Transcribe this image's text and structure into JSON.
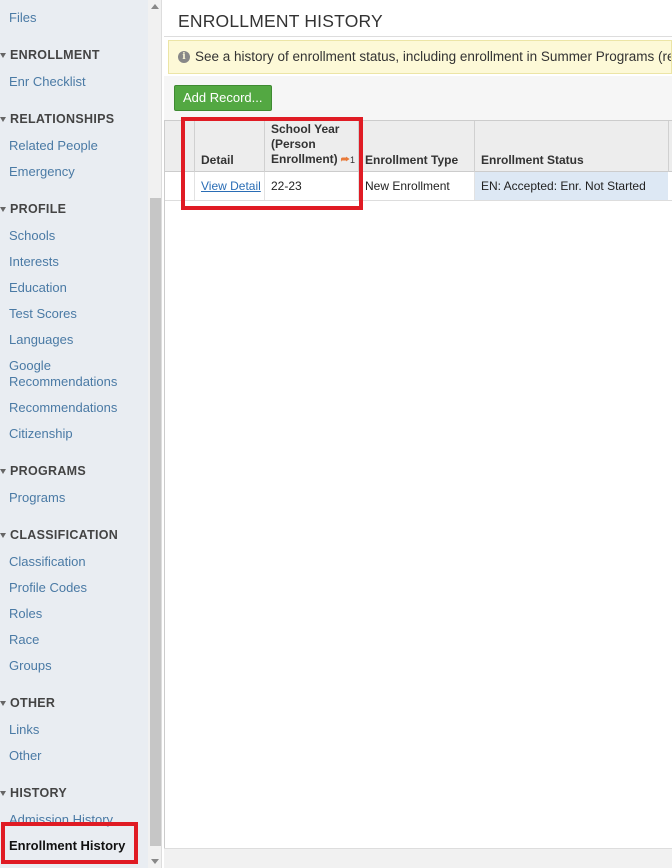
{
  "sidebar": {
    "top_link": "Files",
    "sections": [
      {
        "title": "ENROLLMENT",
        "items": [
          "Enr Checklist"
        ]
      },
      {
        "title": "RELATIONSHIPS",
        "items": [
          "Related People",
          "Emergency"
        ]
      },
      {
        "title": "PROFILE",
        "items": [
          "Schools",
          "Interests",
          "Education",
          "Test Scores",
          "Languages",
          "Google Recommendations",
          "Recommendations",
          "Citizenship"
        ]
      },
      {
        "title": "PROGRAMS",
        "items": [
          "Programs"
        ]
      },
      {
        "title": "CLASSIFICATION",
        "items": [
          "Classification",
          "Profile Codes",
          "Roles",
          "Race",
          "Groups"
        ]
      },
      {
        "title": "OTHER",
        "items": [
          "Links",
          "Other"
        ]
      },
      {
        "title": "HISTORY",
        "items": [
          "Admission History",
          "Enrollment History"
        ]
      }
    ],
    "active_item": "Enrollment History"
  },
  "main": {
    "title": "ENROLLMENT HISTORY",
    "info": "See a history of enrollment status, including enrollment in Summer Programs (repl",
    "add_button": "Add Record...",
    "columns": [
      "Detail",
      "School Year (Person Enrollment)",
      "Enrollment Type",
      "Enrollment Status"
    ],
    "sort_indicator": "1",
    "rows": [
      {
        "detail": "View Detail",
        "school_year": "22-23",
        "enrollment_type": "New Enrollment",
        "enrollment_status": "EN: Accepted: Enr. Not Started"
      }
    ]
  },
  "colors": {
    "sidebar_bg": "#e9edf2",
    "link": "#4a7aa5",
    "button_green": "#53a842",
    "info_bg": "#fdf9d7",
    "highlight_red": "#e01b24",
    "status_cell_bg": "#dde8f4"
  },
  "icons": {
    "info": "info-circle-icon",
    "sort": "sort-descending-icon",
    "section_toggle": "triangle-down-icon"
  }
}
